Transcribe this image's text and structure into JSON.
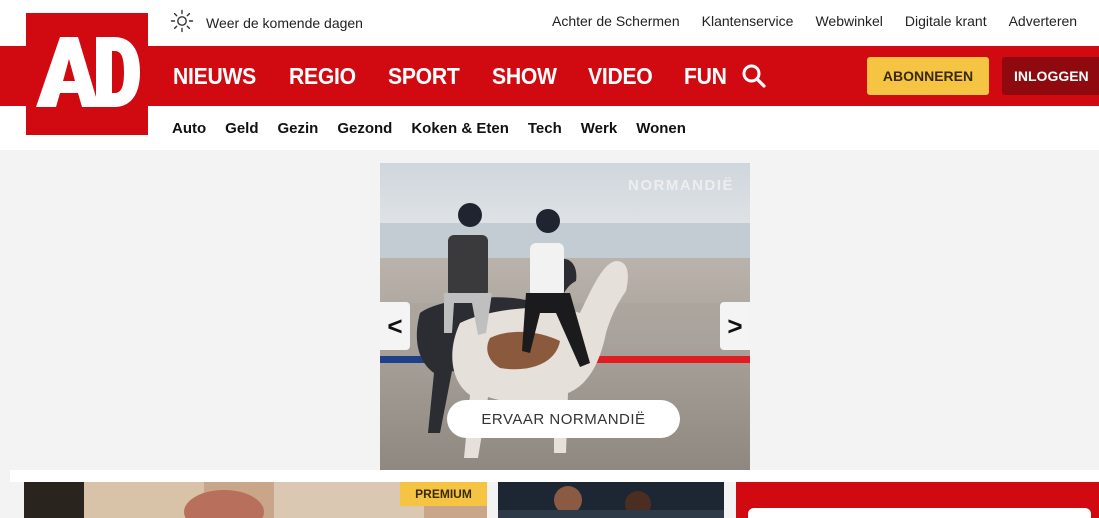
{
  "brand": {
    "logo_text": "AD",
    "primary_color": "#d10a11",
    "accent_color": "#f5c443"
  },
  "top_bar": {
    "weather_label": "Weer de komende dagen",
    "weather_icon": "sun-icon",
    "links": [
      "Achter de Schermen",
      "Klantenservice",
      "Webwinkel",
      "Digitale krant",
      "Adverteren"
    ]
  },
  "main_nav": {
    "items": [
      "NIEUWS",
      "REGIO",
      "SPORT",
      "SHOW",
      "VIDEO",
      "FUN"
    ],
    "search_icon": "search-icon",
    "subscribe_label": "ABONNEREN",
    "login_label": "INLOGGEN"
  },
  "sub_nav": {
    "items": [
      "Auto",
      "Geld",
      "Gezin",
      "Gezond",
      "Koken & Eten",
      "Tech",
      "Werk",
      "Wonen"
    ]
  },
  "ad": {
    "label": "NORMANDIË",
    "cta_label": "ERVAAR NORMANDIË",
    "prev_arrow": "<",
    "next_arrow": ">"
  },
  "tiles": {
    "premium_badge": "PREMIUM"
  }
}
